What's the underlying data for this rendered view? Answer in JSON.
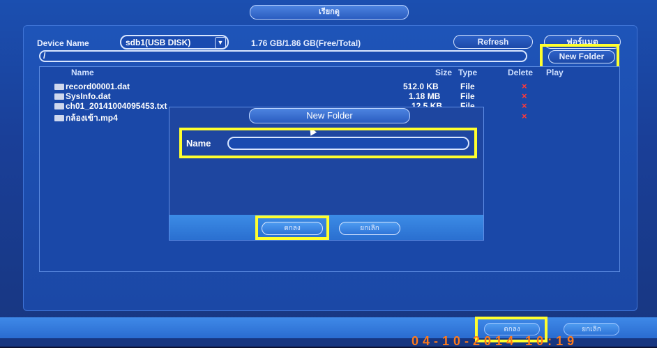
{
  "window": {
    "title": "เรียกดู"
  },
  "device": {
    "label": "Device Name",
    "selected": "sdb1(USB DISK)",
    "capacity": "1.76 GB/1.86 GB(Free/Total)"
  },
  "toolbar": {
    "refresh_label": "Refresh",
    "format_label": "ฟอร์แมต",
    "new_folder_label": "New Folder",
    "path_value": "/"
  },
  "table": {
    "headers": {
      "name": "Name",
      "size": "Size",
      "type": "Type",
      "delete": "Delete",
      "play": "Play"
    },
    "rows": [
      {
        "name": "record00001.dat",
        "size": "512.0 KB",
        "type": "File",
        "delete": "×"
      },
      {
        "name": "SysInfo.dat",
        "size": "1.18 MB",
        "type": "File",
        "delete": "×"
      },
      {
        "name": "ch01_20141004095453.txt",
        "size": "12.5 KB",
        "type": "File",
        "delete": "×"
      },
      {
        "name": "กล้องเข้า.mp4",
        "size": "",
        "type": "",
        "delete": "×"
      }
    ]
  },
  "dialog": {
    "title": "New Folder",
    "name_label": "Name",
    "name_value": "",
    "ok_label": "ตกลง",
    "cancel_label": "ยกเลิก"
  },
  "footer": {
    "ok_label": "ตกลง",
    "cancel_label": "ยกเลิก",
    "clock_text": "04-10-2014 10:19"
  },
  "colors": {
    "highlight": "#ffff2e",
    "delete": "#ff3a3a",
    "accent": "#2a6cd0"
  }
}
